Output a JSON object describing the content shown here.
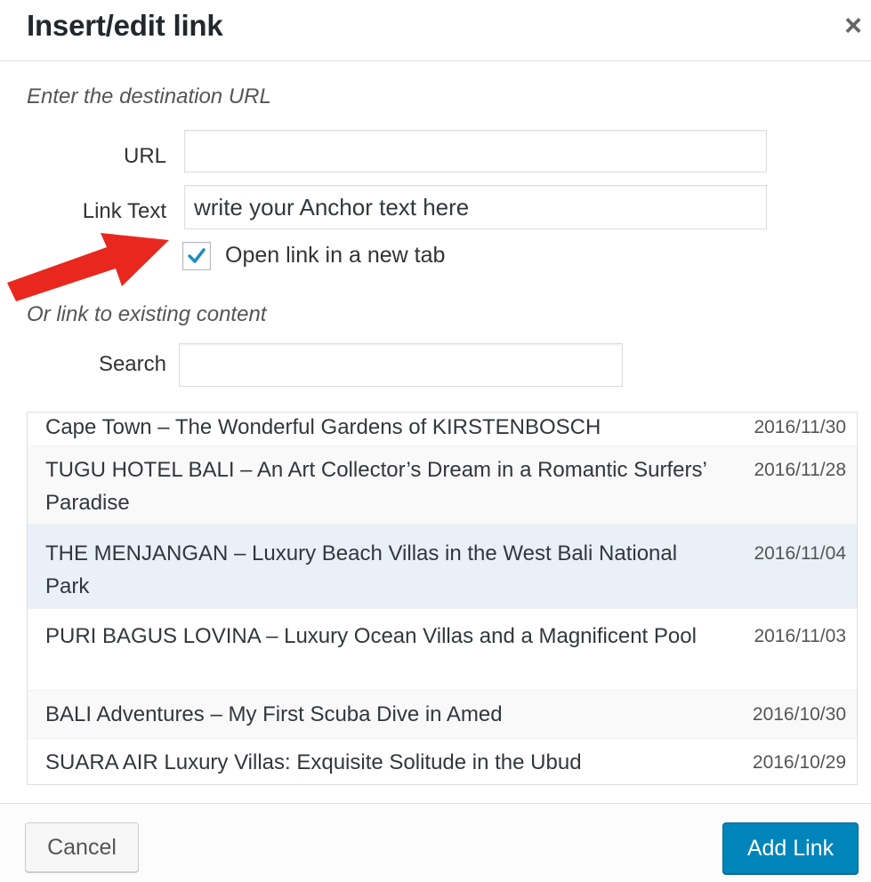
{
  "dialog": {
    "title": "Insert/edit link",
    "close_icon": "close-icon"
  },
  "url_section": {
    "heading": "Enter the destination URL",
    "url_label": "URL",
    "url_value": "",
    "link_text_label": "Link Text",
    "link_text_value": "write your Anchor text here",
    "new_tab_checked": true,
    "new_tab_label": "Open link in a new tab"
  },
  "existing_section": {
    "heading": "Or link to existing content",
    "search_label": "Search",
    "search_value": ""
  },
  "results": [
    {
      "title": "Cape Town – The Wonderful Gardens of KIRSTENBOSCH",
      "date": "2016/11/30"
    },
    {
      "title": "TUGU HOTEL BALI – An Art Collector’s Dream in a Romantic Surfers’ Paradise",
      "date": "2016/11/28"
    },
    {
      "title": "THE MENJANGAN – Luxury Beach Villas in the West Bali National Park",
      "date": "2016/11/04"
    },
    {
      "title": "PURI BAGUS LOVINA – Luxury Ocean Villas and a Magnificent Pool",
      "date": "2016/11/03"
    },
    {
      "title": "BALI Adventures – My First Scuba Dive in Amed",
      "date": "2016/10/30"
    },
    {
      "title": "SUARA AIR Luxury Villas: Exquisite Solitude in the Ubud",
      "date": "2016/10/29"
    }
  ],
  "footer": {
    "cancel_label": "Cancel",
    "add_link_label": "Add Link"
  },
  "colors": {
    "primary_button": "#0085ba",
    "annotation_arrow": "#e8281e",
    "checkmark": "#1e8cbe",
    "selected_row": "#e9f0f8"
  }
}
